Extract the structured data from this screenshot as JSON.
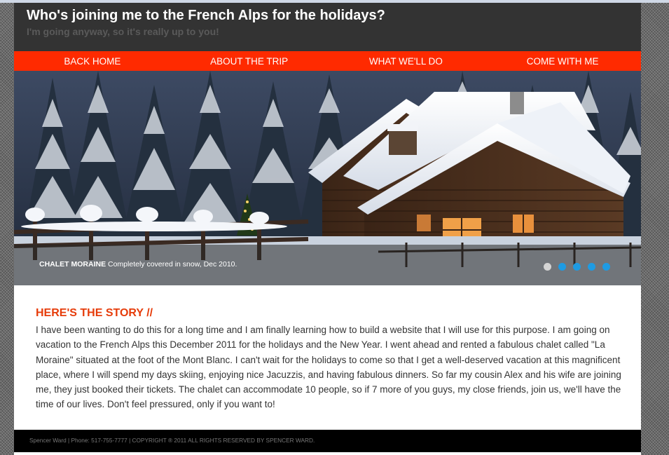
{
  "header": {
    "title": "Who's joining me to the French Alps for the holidays?",
    "subtitle": "I'm going anyway, so it's really up to you!"
  },
  "nav": {
    "items": [
      {
        "label": "BACK HOME"
      },
      {
        "label": "ABOUT THE TRIP"
      },
      {
        "label": "WHAT WE'LL DO"
      },
      {
        "label": "COME WITH ME"
      }
    ]
  },
  "slider": {
    "caption_title": "CHALET MORAINE",
    "caption_text": " Completely covered in snow, Dec 2010.",
    "slide_count": 5,
    "active_slide": 1,
    "dot_color": "#1e9be3",
    "active_dot_color": "#d4d4d4"
  },
  "story": {
    "heading": "HERE'S THE STORY //",
    "text": "I have been wanting to do this for a long time and I am finally learning how to build a website that I will use for this purpose. I am going on vacation to the French Alps this December 2011 for the holidays and the New Year. I went ahead and rented a fabulous chalet called \"La Moraine\" situated at the foot of the Mont Blanc. I can't wait for the holidays to come so that I get a well-deserved vacation at this magnificent place, where I will spend my days skiing, enjoying nice Jacuzzis, and having fabulous dinners. So far my cousin Alex and his wife are joining me, they just booked their tickets. The chalet can accommodate 10 people, so if 7 more of you guys, my close friends, join us, we'll have the time of our lives. Don't feel pressured, only if you want to!"
  },
  "footer": {
    "text": "Spencer Ward | Phone: 517-755-7777 | COPYRIGHT ® 2011 ALL RIGHTS RESERVED BY SPENCER WARD."
  },
  "colors": {
    "accent": "#ff2a00",
    "heading": "#e63c0a",
    "header_bg": "#333333"
  }
}
